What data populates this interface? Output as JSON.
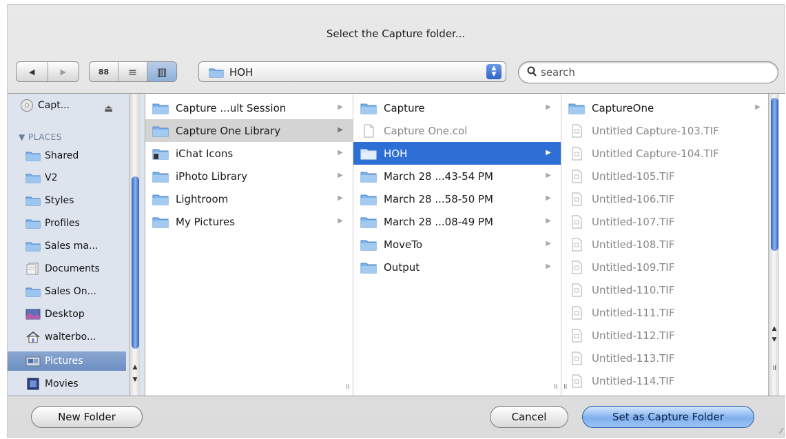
{
  "window": {
    "title": "Select the Capture folder..."
  },
  "toolbar": {
    "back_label": "◀",
    "forward_label": "▶",
    "view_icon_label": "88",
    "view_list_label": "≡",
    "view_column_label": "▥",
    "path_popup_value": "HOH",
    "search_placeholder": "search"
  },
  "sidebar": {
    "device": "Capt...",
    "places_heading": "PLACES",
    "items": [
      {
        "label": "Shared",
        "icon": "folder-icon"
      },
      {
        "label": "V2",
        "icon": "folder-icon"
      },
      {
        "label": "Styles",
        "icon": "folder-icon"
      },
      {
        "label": "Profiles",
        "icon": "folder-icon"
      },
      {
        "label": "Sales ma...",
        "icon": "folder-icon"
      },
      {
        "label": "Documents",
        "icon": "documents-icon"
      },
      {
        "label": "Sales On...",
        "icon": "folder-icon"
      },
      {
        "label": "Desktop",
        "icon": "desktop-icon"
      },
      {
        "label": "walterbo...",
        "icon": "home-icon"
      },
      {
        "label": "Pictures",
        "icon": "pictures-icon",
        "selected": true
      },
      {
        "label": "Movies",
        "icon": "movies-icon"
      }
    ]
  },
  "columns": [
    {
      "items": [
        {
          "label": "Capture ...ult Session",
          "type": "folder"
        },
        {
          "label": "Capture One Library",
          "type": "folder",
          "selected": true
        },
        {
          "label": "iChat Icons",
          "type": "folder"
        },
        {
          "label": "iPhoto Library",
          "type": "folder"
        },
        {
          "label": "Lightroom",
          "type": "folder"
        },
        {
          "label": "My Pictures",
          "type": "folder"
        }
      ]
    },
    {
      "items": [
        {
          "label": "Capture",
          "type": "folder"
        },
        {
          "label": "Capture One.col",
          "type": "file"
        },
        {
          "label": "HOH",
          "type": "folder",
          "active": true
        },
        {
          "label": "March 28 ...43-54 PM",
          "type": "folder"
        },
        {
          "label": "March 28 ...58-50 PM",
          "type": "folder"
        },
        {
          "label": "March 28 ...08-49 PM",
          "type": "folder"
        },
        {
          "label": "MoveTo",
          "type": "folder"
        },
        {
          "label": "Output",
          "type": "folder"
        }
      ]
    },
    {
      "items": [
        {
          "label": "CaptureOne",
          "type": "folder"
        },
        {
          "label": "Untitled Capture-103.TIF",
          "type": "file"
        },
        {
          "label": "Untitled Capture-104.TIF",
          "type": "file"
        },
        {
          "label": "Untitled-105.TIF",
          "type": "file"
        },
        {
          "label": "Untitled-106.TIF",
          "type": "file"
        },
        {
          "label": "Untitled-107.TIF",
          "type": "file"
        },
        {
          "label": "Untitled-108.TIF",
          "type": "file"
        },
        {
          "label": "Untitled-109.TIF",
          "type": "file"
        },
        {
          "label": "Untitled-110.TIF",
          "type": "file"
        },
        {
          "label": "Untitled-111.TIF",
          "type": "file"
        },
        {
          "label": "Untitled-112.TIF",
          "type": "file"
        },
        {
          "label": "Untitled-113.TIF",
          "type": "file"
        },
        {
          "label": "Untitled-114.TIF",
          "type": "file"
        }
      ]
    }
  ],
  "buttons": {
    "new_folder": "New Folder",
    "cancel": "Cancel",
    "confirm": "Set as Capture Folder"
  },
  "colors": {
    "selection_active": "#2e6fd5",
    "selection_inactive": "#d4d4d4",
    "sidebar_bg": "#dde4ee",
    "scroll_thumb": "#3d72cf"
  }
}
